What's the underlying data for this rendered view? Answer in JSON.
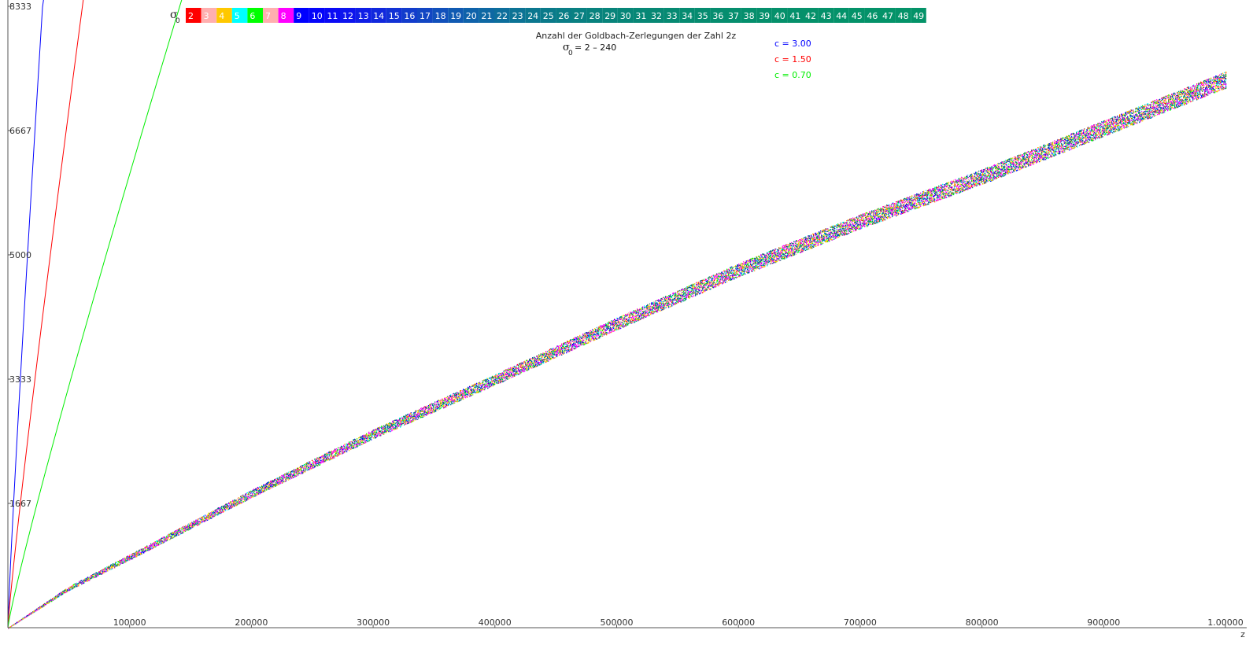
{
  "chart_data": {
    "type": "scatter",
    "title": "Anzahl der Goldbach-Zerlegungen der Zahl 2z",
    "subtitle": {
      "symbol": "σ",
      "subscript": "0",
      "text": "= 2 – 240"
    },
    "xlabel": "z",
    "ylabel": "",
    "xlim": [
      0,
      1000000
    ],
    "ylim": [
      0,
      8333
    ],
    "x_ticks": [
      100000,
      200000,
      300000,
      400000,
      500000,
      600000,
      700000,
      800000,
      900000,
      1000000
    ],
    "x_tick_labels": [
      "100000",
      "200000",
      "300000",
      "400000",
      "500000",
      "600000",
      "700000",
      "800000",
      "900000",
      "1.00000"
    ],
    "y_ticks": [
      1667,
      3333,
      5000,
      6667,
      8333
    ],
    "y_tick_labels": [
      "1667",
      "3333",
      "5000",
      "6667",
      "8333"
    ],
    "grid": false,
    "band": {
      "description_points_x": [
        0,
        50000,
        100000,
        200000,
        300000,
        400000,
        500000,
        600000,
        700000,
        800000,
        900000,
        1000000
      ],
      "center": [
        0,
        530,
        950,
        1800,
        2600,
        3330,
        4080,
        4800,
        5450,
        6050,
        6700,
        7350
      ],
      "halfwidth": [
        0,
        25,
        35,
        50,
        62,
        70,
        80,
        90,
        95,
        100,
        105,
        110
      ]
    },
    "colorscale": {
      "label_symbol": "σ",
      "label_subscript": "0",
      "entries": [
        {
          "label": "2",
          "color": "#ff0000"
        },
        {
          "label": "3",
          "color": "#ffafaf"
        },
        {
          "label": "4",
          "color": "#ffc800"
        },
        {
          "label": "5",
          "color": "#00ffff"
        },
        {
          "label": "6",
          "color": "#00ff00"
        },
        {
          "label": "7",
          "color": "#ffafaf"
        },
        {
          "label": "8",
          "color": "#ff00ff"
        },
        {
          "label": "9",
          "color": "#0000ff"
        },
        {
          "label": "10",
          "color": "#0505fa"
        },
        {
          "label": "11",
          "color": "#0a0af5"
        },
        {
          "label": "12",
          "color": "#0d14ee"
        },
        {
          "label": "13",
          "color": "#0f1ee6"
        },
        {
          "label": "14",
          "color": "#1128dd"
        },
        {
          "label": "15",
          "color": "#1232d5"
        },
        {
          "label": "16",
          "color": "#123ccc"
        },
        {
          "label": "17",
          "color": "#1246c3"
        },
        {
          "label": "18",
          "color": "#1150bb"
        },
        {
          "label": "19",
          "color": "#105ab2"
        },
        {
          "label": "20",
          "color": "#0f62aa"
        },
        {
          "label": "21",
          "color": "#0e68a3"
        },
        {
          "label": "22",
          "color": "#0d6e9c"
        },
        {
          "label": "23",
          "color": "#0c7395"
        },
        {
          "label": "24",
          "color": "#0b778f"
        },
        {
          "label": "25",
          "color": "#0a7a8a"
        },
        {
          "label": "26",
          "color": "#097d86"
        },
        {
          "label": "27",
          "color": "#098082"
        },
        {
          "label": "28",
          "color": "#08827e"
        },
        {
          "label": "29",
          "color": "#08847b"
        },
        {
          "label": "30",
          "color": "#078678"
        },
        {
          "label": "31",
          "color": "#078776"
        },
        {
          "label": "32",
          "color": "#078874"
        },
        {
          "label": "33",
          "color": "#068a72"
        },
        {
          "label": "34",
          "color": "#068b71"
        },
        {
          "label": "35",
          "color": "#068c70"
        },
        {
          "label": "36",
          "color": "#068d6f"
        },
        {
          "label": "37",
          "color": "#058e6e"
        },
        {
          "label": "38",
          "color": "#058f6d"
        },
        {
          "label": "39",
          "color": "#058f6c"
        },
        {
          "label": "40",
          "color": "#05906b"
        },
        {
          "label": "41",
          "color": "#05906b"
        },
        {
          "label": "42",
          "color": "#05916a"
        },
        {
          "label": "43",
          "color": "#05916a"
        },
        {
          "label": "44",
          "color": "#04926a"
        },
        {
          "label": "45",
          "color": "#049269"
        },
        {
          "label": "46",
          "color": "#049269"
        },
        {
          "label": "47",
          "color": "#049369"
        },
        {
          "label": "48",
          "color": "#049369"
        },
        {
          "label": "49",
          "color": "#049368"
        }
      ]
    },
    "band_colors": [
      "#ff0000",
      "#ffafaf",
      "#ffc800",
      "#00ffff",
      "#00ff00",
      "#ff00ff",
      "#0000ff",
      "#0c7395",
      "#078874",
      "#ffc800",
      "#ff00ff"
    ],
    "series": [
      {
        "name": "c = 3.00",
        "c": 3.0,
        "color": "#0000ff"
      },
      {
        "name": "c = 1.50",
        "c": 1.5,
        "color": "#ff0000"
      },
      {
        "name": "c = 0.70",
        "c": 0.7,
        "color": "#00ee00"
      }
    ],
    "legend_position": "top-center"
  }
}
